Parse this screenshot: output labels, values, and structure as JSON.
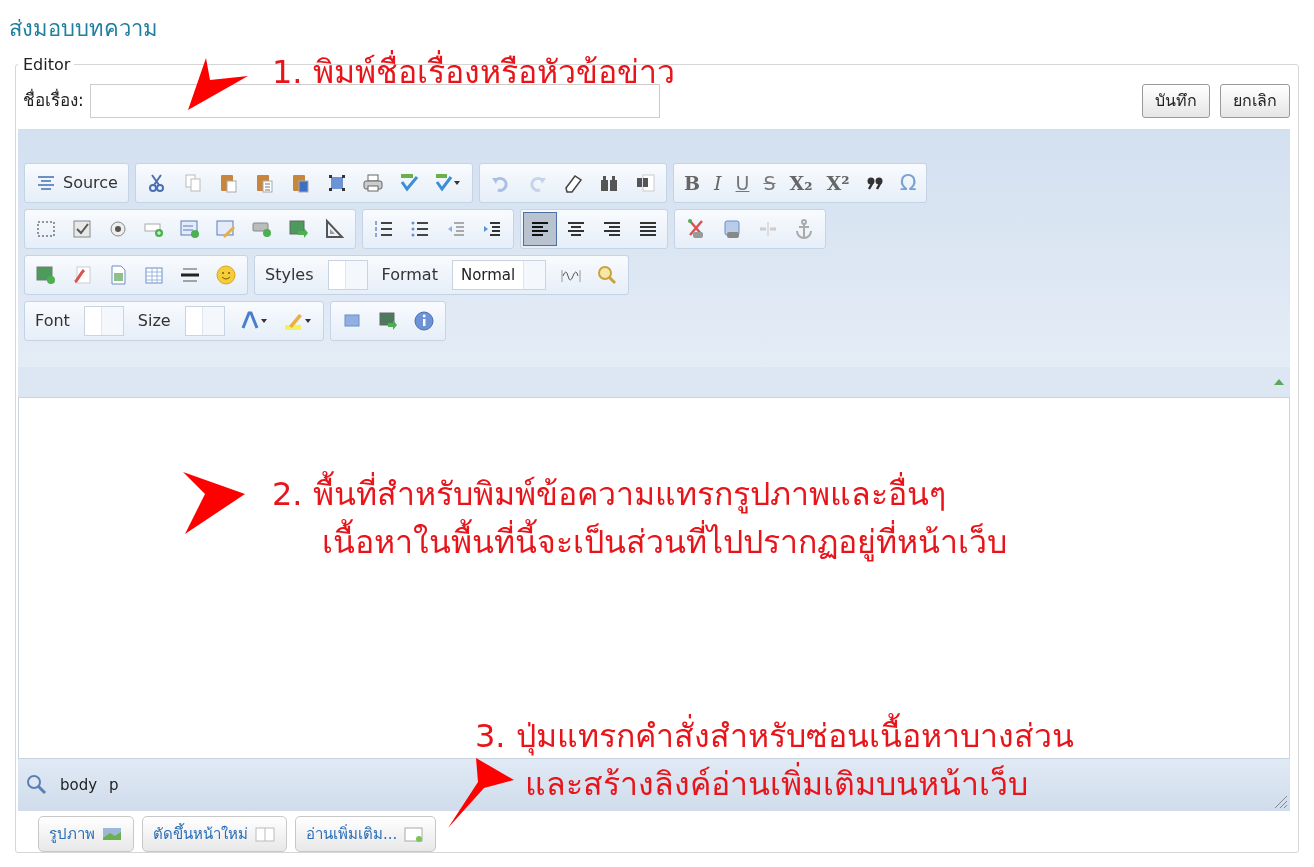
{
  "page_title": "ส่งมอบบทความ",
  "editor": {
    "legend": "Editor",
    "title_label": "ชื่อเรื่อง:",
    "buttons": [
      "บันทึก",
      "ยกเลิก"
    ],
    "toolbar": {
      "source_label": "Source",
      "format_marks": [
        "B",
        "I",
        "U",
        "S",
        "X₂",
        "X²",
        "Ω"
      ],
      "alignment": [
        {
          "selected": true
        },
        {
          "selected": false
        },
        {
          "selected": false
        },
        {
          "selected": false
        }
      ],
      "styles_label": "Styles",
      "format_label": "Format",
      "format_value": "Normal",
      "font_label": "Font",
      "size_label": "Size"
    },
    "status_path": [
      "body",
      "p"
    ],
    "insert_buttons": [
      "รูปภาพ",
      "ตัดขึ้นหน้าใหม่",
      "อ่านเพิ่มเติม..."
    ]
  },
  "annotations": [
    {
      "lines": [
        "1. พิมพ์ชื่อเรื่องหรือหัวข้อข่าว"
      ]
    },
    {
      "lines": [
        "2. พื้นที่สำหรับพิมพ์ข้อความแทรกรูปภาพและอื่นๆ",
        "เนื้อหาในพื้นที่นี้จะเป็นส่วนที่ไปปรากฏอยู่ที่หน้าเว็บ"
      ]
    },
    {
      "lines": [
        "3. ปุ่มแทรกคำสั่งสำหรับซ่อนเนื้อหาบางส่วน",
        "และสร้างลิงค์อ่านเพิ่มเติมบนหน้าเว็บ"
      ]
    }
  ]
}
